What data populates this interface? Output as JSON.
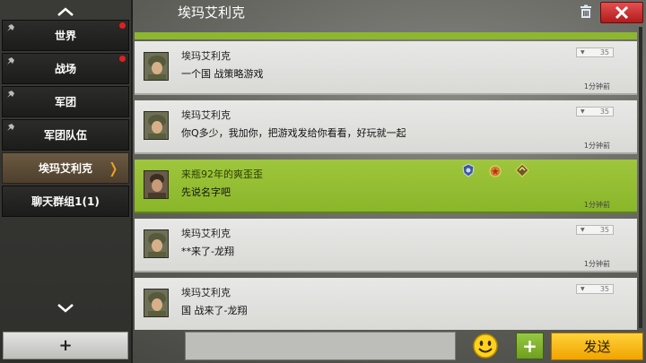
{
  "header": {
    "title": "埃玛艾利克"
  },
  "sidebar": {
    "items": [
      {
        "label": "世界",
        "unread": true,
        "pinned": true
      },
      {
        "label": "战场",
        "unread": true,
        "pinned": true
      },
      {
        "label": "军团",
        "unread": false,
        "pinned": true
      },
      {
        "label": "军团队伍",
        "unread": false,
        "pinned": true
      },
      {
        "label": "埃玛艾利克",
        "unread": false,
        "pinned": false,
        "active": true
      },
      {
        "label": "聊天群组1(1)",
        "unread": false,
        "pinned": false
      }
    ],
    "add_label": "+"
  },
  "messages": [
    {
      "name": "埃玛艾利克",
      "text": "一个国 战策略游戏",
      "time": "1分钟前",
      "level": "35",
      "highlight": false
    },
    {
      "name": "埃玛艾利克",
      "text": "你Q多少，我加你，把游戏发给你看看，好玩就一起",
      "time": "1分钟前",
      "level": "35",
      "highlight": false
    },
    {
      "name": "来瓶92年的爽歪歪",
      "text": "先说名字吧",
      "time": "1分钟前",
      "level": "",
      "highlight": true
    },
    {
      "name": "埃玛艾利克",
      "text": "**来了-龙翔",
      "time": "1分钟前",
      "level": "35",
      "highlight": false
    },
    {
      "name": "埃玛艾利克",
      "text": "国 战来了-龙翔",
      "time": "",
      "level": "35",
      "highlight": false
    }
  ],
  "bottom": {
    "plus_label": "+",
    "send_label": "发送"
  },
  "icons": {
    "trash": "trash-icon",
    "close": "close-icon",
    "emoji": "smiley-icon",
    "scroll_up": "chevron-up-icon",
    "scroll_down": "chevron-down-icon"
  },
  "colors": {
    "highlight": "#8cb72e",
    "close": "#c42a2a",
    "send": "#f5b400",
    "unread_dot": "#e02020"
  }
}
